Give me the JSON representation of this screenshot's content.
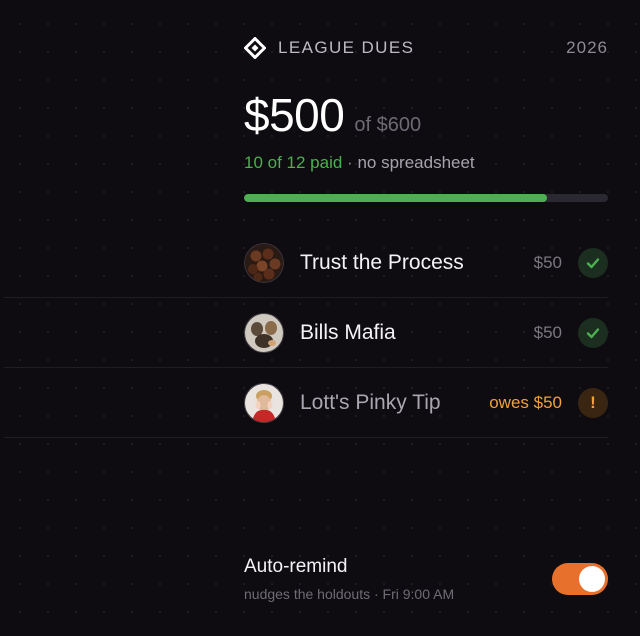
{
  "header": {
    "title": "LEAGUE DUES",
    "year": "2026",
    "icon": "diamond-logo-icon"
  },
  "summary": {
    "collected": "$500",
    "of_total": "of $600",
    "paid_text": "10 of 12 paid",
    "separator": "·",
    "note": "no spreadsheet",
    "progress_fraction": 0.8333
  },
  "members": [
    {
      "name": "Trust the Process",
      "amount": "$50",
      "status": "paid",
      "status_icon": "check-icon",
      "avatar": "basketballs-avatar"
    },
    {
      "name": "Bills Mafia",
      "amount": "$50",
      "status": "paid",
      "status_icon": "check-icon",
      "avatar": "team-photo-avatar"
    },
    {
      "name": "Lott's Pinky Tip",
      "amount": "owes $50",
      "status": "owes",
      "status_icon": "exclamation-icon",
      "status_glyph": "!",
      "avatar": "player-photo-avatar"
    }
  ],
  "auto_remind": {
    "title": "Auto-remind",
    "subtitle": "nudges the holdouts · Fri 9:00 AM",
    "enabled": true
  },
  "colors": {
    "paid_green": "#4caf50",
    "owes_orange": "#f0a13a",
    "toggle_orange": "#e8702d",
    "background": "#0e0c10"
  }
}
